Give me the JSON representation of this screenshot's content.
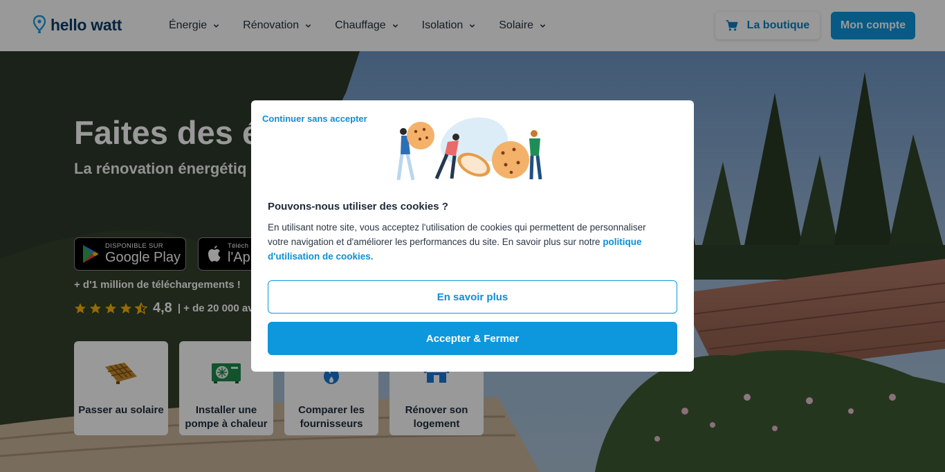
{
  "header": {
    "logo_text": "hello watt",
    "nav": [
      {
        "label": "Énergie"
      },
      {
        "label": "Rénovation"
      },
      {
        "label": "Chauffage"
      },
      {
        "label": "Isolation"
      },
      {
        "label": "Solaire"
      }
    ],
    "shop_label": "La boutique",
    "account_label": "Mon compte"
  },
  "hero": {
    "title": "Faites des éc",
    "subtitle": "La rénovation énergétiq",
    "google_play": {
      "small": "DISPONIBLE SUR",
      "big": "Google Play"
    },
    "app_store": {
      "small": "Téléch",
      "big": "l'App"
    },
    "downloads": "+ d'1 million de téléchargements !",
    "rating": {
      "stars": 4.5,
      "value": "4,8",
      "reviews": "| + de 20 000 avi"
    },
    "cards": [
      {
        "label": "Passer au solaire",
        "icon": "solar-panel-icon"
      },
      {
        "label": "Installer une pompe à chaleur",
        "icon": "heat-pump-icon"
      },
      {
        "label": "Comparer les fournisseurs",
        "icon": "energy-flame-icon"
      },
      {
        "label": "Rénover son logement",
        "icon": "house-icon"
      }
    ]
  },
  "cookie_modal": {
    "continue_without": "Continuer sans accepter",
    "title": "Pouvons-nous utiliser des cookies ?",
    "body": "En utilisant notre site, vous acceptez l'utilisation de cookies qui permettent de personnaliser votre navigation et d'améliorer les performances du site. En savoir plus sur notre ",
    "policy_link": "politique d'utilisation de cookies.",
    "learn_more": "En savoir plus",
    "accept": "Accepter & Fermer"
  },
  "colors": {
    "brand_blue": "#0d97dc",
    "brand_navy": "#0a3d6b",
    "link_blue": "#0d8fd6"
  }
}
